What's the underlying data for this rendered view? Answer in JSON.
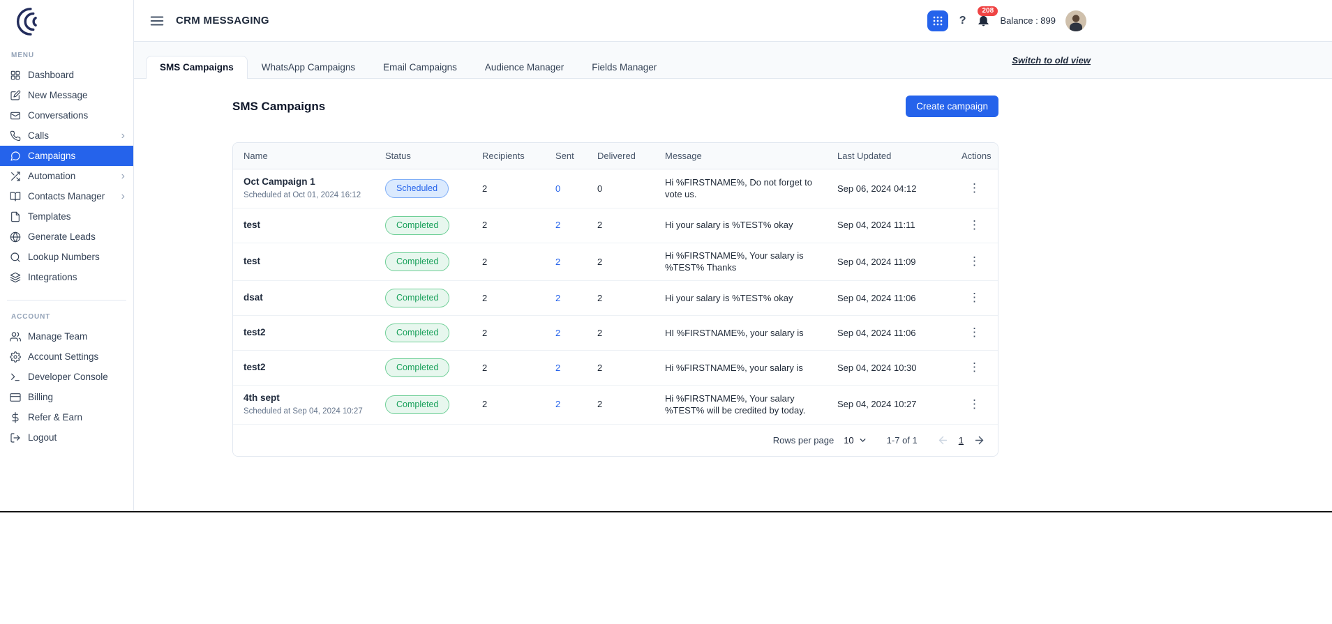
{
  "colors": {
    "accent": "#2563eb",
    "link": "#2563eb",
    "badge_red": "#ef4444",
    "scheduled_text": "#2563eb",
    "scheduled_bg": "#dbeafe",
    "scheduled_border": "#7eadf7",
    "completed_text": "#18a05a",
    "completed_bg": "#e7f7ee",
    "completed_border": "#6fcf97"
  },
  "header": {
    "title": "CRM MESSAGING",
    "notification_count": "208",
    "balance": "Balance : 899",
    "apps_icon": "apps-grid-icon",
    "help_icon": "help-icon",
    "bell_icon": "notification-bell-icon",
    "avatar": "user-avatar"
  },
  "sidebar": {
    "menu_label": "MENU",
    "account_label": "ACCOUNT",
    "menu_items": [
      {
        "label": "Dashboard",
        "icon": "dashboard-icon"
      },
      {
        "label": "New Message",
        "icon": "new-message-icon"
      },
      {
        "label": "Conversations",
        "icon": "conversations-icon"
      },
      {
        "label": "Calls",
        "icon": "calls-icon",
        "chevron": true
      },
      {
        "label": "Campaigns",
        "icon": "campaigns-icon",
        "active": true
      },
      {
        "label": "Automation",
        "icon": "automation-icon",
        "chevron": true
      },
      {
        "label": "Contacts Manager",
        "icon": "contacts-manager-icon",
        "chevron": true
      },
      {
        "label": "Templates",
        "icon": "templates-icon"
      },
      {
        "label": "Generate Leads",
        "icon": "generate-leads-icon"
      },
      {
        "label": "Lookup Numbers",
        "icon": "lookup-numbers-icon"
      },
      {
        "label": "Integrations",
        "icon": "integrations-icon"
      }
    ],
    "account_items": [
      {
        "label": "Manage Team",
        "icon": "manage-team-icon"
      },
      {
        "label": "Account Settings",
        "icon": "account-settings-icon"
      },
      {
        "label": "Developer Console",
        "icon": "developer-console-icon"
      },
      {
        "label": "Billing",
        "icon": "billing-icon"
      },
      {
        "label": "Refer & Earn",
        "icon": "refer-earn-icon"
      },
      {
        "label": "Logout",
        "icon": "logout-icon"
      }
    ]
  },
  "tabs": [
    {
      "label": "SMS Campaigns",
      "active": true
    },
    {
      "label": "WhatsApp Campaigns"
    },
    {
      "label": "Email Campaigns"
    },
    {
      "label": "Audience Manager"
    },
    {
      "label": "Fields Manager"
    }
  ],
  "switch_view_link": "Switch to old view",
  "page": {
    "title": "SMS Campaigns",
    "create_button": "Create campaign"
  },
  "table": {
    "columns": [
      "Name",
      "Status",
      "Recipients",
      "Sent",
      "Delivered",
      "Message",
      "Last Updated",
      "Actions"
    ],
    "rows": [
      {
        "name": "Oct Campaign 1",
        "subtitle": "Scheduled at Oct 01, 2024 16:12",
        "status": "Scheduled",
        "recipients": "2",
        "sent": "0",
        "delivered": "0",
        "message": "Hi %FIRSTNAME%, Do not forget to vote us.",
        "updated": "Sep 06, 2024 04:12"
      },
      {
        "name": "test",
        "status": "Completed",
        "recipients": "2",
        "sent": "2",
        "delivered": "2",
        "message": "Hi your salary is %TEST% okay",
        "updated": "Sep 04, 2024 11:11"
      },
      {
        "name": "test",
        "status": "Completed",
        "recipients": "2",
        "sent": "2",
        "delivered": "2",
        "message": "Hi %FIRSTNAME%, Your salary is %TEST% Thanks",
        "updated": "Sep 04, 2024 11:09"
      },
      {
        "name": "dsat",
        "status": "Completed",
        "recipients": "2",
        "sent": "2",
        "delivered": "2",
        "message": "Hi your salary is %TEST% okay",
        "updated": "Sep 04, 2024 11:06"
      },
      {
        "name": "test2",
        "status": "Completed",
        "recipients": "2",
        "sent": "2",
        "delivered": "2",
        "message": "HI %FIRSTNAME%, your salary is",
        "updated": "Sep 04, 2024 11:06"
      },
      {
        "name": "test2",
        "status": "Completed",
        "recipients": "2",
        "sent": "2",
        "delivered": "2",
        "message": "Hi %FIRSTNAME%, your salary is",
        "updated": "Sep 04, 2024 10:30"
      },
      {
        "name": "4th sept",
        "subtitle": "Scheduled at Sep 04, 2024 10:27",
        "status": "Completed",
        "recipients": "2",
        "sent": "2",
        "delivered": "2",
        "message": "Hi %FIRSTNAME%, Your salary %TEST% will be credited by today.",
        "updated": "Sep 04, 2024 10:27"
      }
    ]
  },
  "pagination": {
    "rows_per_page_label": "Rows per page",
    "rows_per_page_value": "10",
    "range_label": "1-7 of 1",
    "current_page": "1"
  }
}
